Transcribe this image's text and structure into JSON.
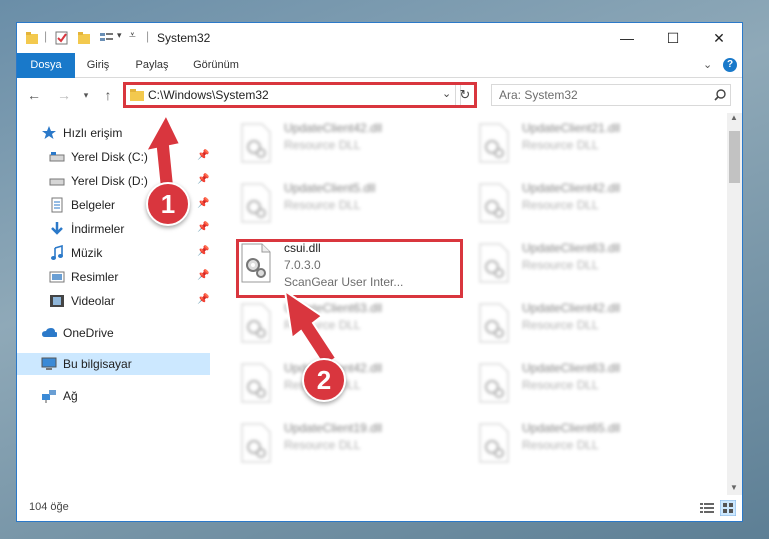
{
  "window": {
    "title": "System32",
    "controls": {
      "minimize": "—",
      "maximize": "☐",
      "close": "✕"
    }
  },
  "ribbon": {
    "tabs": [
      "Dosya",
      "Giriş",
      "Paylaş",
      "Görünüm"
    ],
    "expand_icon": "chevron-down-icon",
    "help_icon": "?"
  },
  "address": {
    "path": "C:\\Windows\\System32",
    "search_placeholder": "Ara: System32"
  },
  "nav": {
    "quick_access": "Hızlı erişim",
    "items": [
      {
        "label": "Yerel Disk (C:)",
        "icon": "drive-icon",
        "pinned": true
      },
      {
        "label": "Yerel Disk (D:)",
        "icon": "drive-icon",
        "pinned": true
      },
      {
        "label": "Belgeler",
        "icon": "documents-icon",
        "pinned": true
      },
      {
        "label": "İndirmeler",
        "icon": "download-icon",
        "pinned": true
      },
      {
        "label": "Müzik",
        "icon": "music-icon",
        "pinned": true
      },
      {
        "label": "Resimler",
        "icon": "pictures-icon",
        "pinned": true
      },
      {
        "label": "Videolar",
        "icon": "videos-icon",
        "pinned": true
      }
    ],
    "onedrive": "OneDrive",
    "this_pc": "Bu bilgisayar",
    "network": "Ağ"
  },
  "files": {
    "left": [
      {
        "name": "UpdateClient42.dll",
        "type": "Resource DLL"
      },
      {
        "name": "UpdateClient5.dll",
        "type": "Resource DLL"
      },
      {
        "name": "csui.dll",
        "version": "7.0.3.0",
        "description": "ScanGear User Inter..."
      },
      {
        "name": "UpdateClient63.dll",
        "type": "Resource DLL"
      },
      {
        "name": "UpdateClient42.dll",
        "type": "Resource DLL"
      },
      {
        "name": "UpdateClient19.dll",
        "type": "Resource DLL"
      }
    ],
    "right": [
      {
        "name": "UpdateClient21.dll",
        "type": "Resource DLL"
      },
      {
        "name": "UpdateClient42.dll",
        "type": "Resource DLL"
      },
      {
        "name": "UpdateClient63.dll",
        "type": "Resource DLL"
      },
      {
        "name": "UpdateClient42.dll",
        "type": "Resource DLL"
      },
      {
        "name": "UpdateClient63.dll",
        "type": "Resource DLL"
      },
      {
        "name": "UpdateClient65.dll",
        "type": "Resource DLL"
      }
    ]
  },
  "status": {
    "item_count": "104 öğe"
  },
  "markers": {
    "one": "1",
    "two": "2"
  },
  "colors": {
    "accent": "#1979ca",
    "highlight": "#d9363e",
    "selection": "#cce8ff"
  }
}
